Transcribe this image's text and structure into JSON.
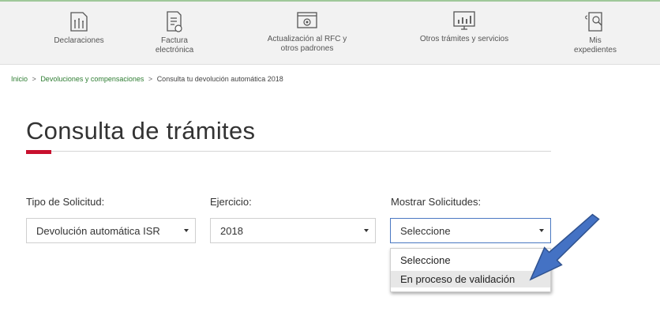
{
  "nav": {
    "items": [
      {
        "label": "Declaraciones",
        "icon": "declaraciones-icon"
      },
      {
        "label": "Factura\nelectrónica",
        "icon": "factura-icon"
      },
      {
        "label": "Actualización al RFC y\notros padrones",
        "icon": "rfc-icon"
      },
      {
        "label": "Otros trámites y servicios",
        "icon": "tramites-icon"
      },
      {
        "label": "Mis\nexpedientes",
        "icon": "expedientes-icon"
      }
    ]
  },
  "breadcrumb": {
    "items": [
      "Inicio",
      "Devoluciones y compensaciones",
      "Consulta tu devolución automática 2018"
    ],
    "separator": ">"
  },
  "page": {
    "title": "Consulta de trámites"
  },
  "form": {
    "tipo": {
      "label": "Tipo de Solicitud:",
      "value": "Devolución automática ISR"
    },
    "ejercicio": {
      "label": "Ejercicio:",
      "value": "2018"
    },
    "mostrar": {
      "label": "Mostrar Solicitudes:",
      "value": "Seleccione",
      "options": [
        "Seleccione",
        "En proceso de validación"
      ],
      "highlighted_option": "En proceso de validación"
    }
  },
  "colors": {
    "accent_red": "#c8102e",
    "breadcrumb_link": "#2e7d32",
    "arrow_fill": "#4472c4",
    "nav_background": "#f2f2f2"
  }
}
